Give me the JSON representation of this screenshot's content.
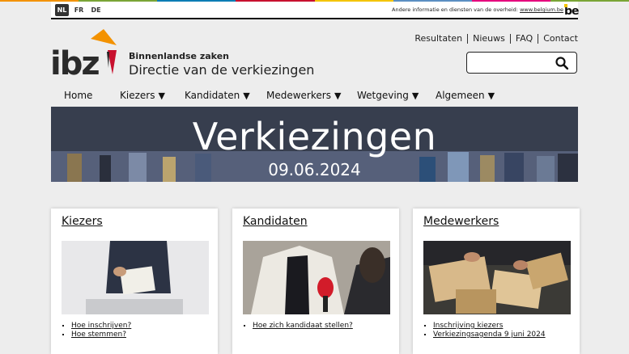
{
  "federal_bar": {
    "languages": [
      {
        "code": "NL",
        "active": true
      },
      {
        "code": "FR",
        "active": false
      },
      {
        "code": "DE",
        "active": false
      }
    ],
    "other_info_text": "Andere informatie en diensten van de overheid:",
    "other_info_link": "www.belgium.be",
    "be_logo": "be"
  },
  "header": {
    "logo_text": "ibz",
    "org_subtitle": "Binnenlandse zaken",
    "org_title": "Directie van de verkiezingen",
    "top_links": [
      "Resultaten",
      "Nieuws",
      "FAQ",
      "Contact"
    ],
    "search_icon": "search-icon"
  },
  "nav": {
    "items": [
      {
        "label": "Home",
        "dropdown": false
      },
      {
        "label": "Kiezers",
        "dropdown": true
      },
      {
        "label": "Kandidaten",
        "dropdown": true
      },
      {
        "label": "Medewerkers",
        "dropdown": true
      },
      {
        "label": "Wetgeving",
        "dropdown": true
      },
      {
        "label": "Algemeen",
        "dropdown": true
      }
    ],
    "caret": "▼"
  },
  "banner": {
    "title": "Verkiezingen",
    "date": "09.06.2024"
  },
  "cards": [
    {
      "title": "Kiezers",
      "links": [
        "Hoe inschrijven?",
        "Hoe stemmen?"
      ]
    },
    {
      "title": "Kandidaten",
      "links": [
        "Hoe zich kandidaat stellen?"
      ]
    },
    {
      "title": "Medewerkers",
      "links": [
        "Inschrijving kiezers",
        "Verkiezingsagenda 9 juni 2024"
      ]
    }
  ],
  "colors": {
    "brand_orange": "#f39200",
    "brand_red": "#c8102e",
    "flag_yellow": "#f4c400",
    "dark": "#1b1b1b"
  }
}
